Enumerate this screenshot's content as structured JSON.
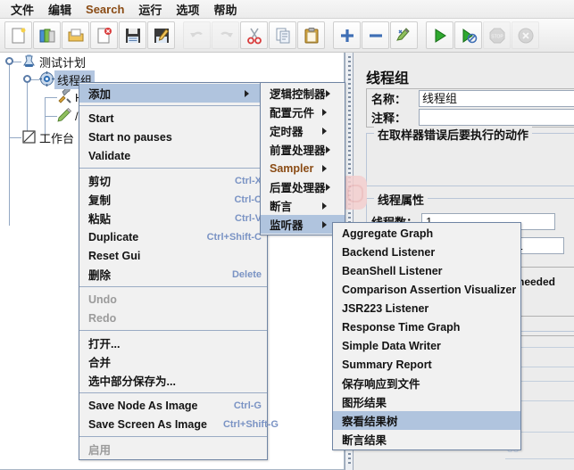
{
  "menubar": {
    "items": [
      {
        "label": "文件",
        "accent": false
      },
      {
        "label": "编辑",
        "accent": false
      },
      {
        "label": "Search",
        "accent": true
      },
      {
        "label": "运行",
        "accent": false
      },
      {
        "label": "选项",
        "accent": false
      },
      {
        "label": "帮助",
        "accent": false
      }
    ]
  },
  "toolbar": {
    "buttons": [
      {
        "name": "new-icon",
        "enabled": true
      },
      {
        "name": "templates-icon",
        "enabled": true
      },
      {
        "name": "open-icon",
        "enabled": true
      },
      {
        "name": "close-icon",
        "enabled": true
      },
      {
        "name": "save-icon",
        "enabled": true
      },
      {
        "name": "save-as-icon",
        "enabled": true
      },
      {
        "name": "undo-icon",
        "enabled": false
      },
      {
        "name": "redo-icon",
        "enabled": false
      },
      {
        "name": "cut-icon",
        "enabled": true
      },
      {
        "name": "copy-icon",
        "enabled": true
      },
      {
        "name": "paste-icon",
        "enabled": true
      },
      {
        "name": "expand-all-icon",
        "enabled": true
      },
      {
        "name": "collapse-all-icon",
        "enabled": true
      },
      {
        "name": "toggle-icon",
        "enabled": true
      },
      {
        "name": "start-icon",
        "enabled": true
      },
      {
        "name": "start-no-pauses-icon",
        "enabled": true
      },
      {
        "name": "stop-icon",
        "enabled": false
      },
      {
        "name": "shutdown-icon",
        "enabled": false
      }
    ]
  },
  "tree": {
    "nodes": [
      {
        "label": "测试计划",
        "selected": false
      },
      {
        "label": "线程组",
        "selected": true
      },
      {
        "label": "H",
        "selected": false
      },
      {
        "label": "/",
        "selected": false
      },
      {
        "label": "工作台",
        "selected": false
      }
    ]
  },
  "context_menu": {
    "items": [
      {
        "label": "添加",
        "accel": "",
        "submenu": true,
        "highlighted": true,
        "disabled": false,
        "accent": false
      },
      {
        "type": "separator"
      },
      {
        "label": "Start",
        "accel": "",
        "submenu": false,
        "highlighted": false,
        "disabled": false,
        "accent": false
      },
      {
        "label": "Start no pauses",
        "accel": "",
        "submenu": false,
        "highlighted": false,
        "disabled": false,
        "accent": false
      },
      {
        "label": "Validate",
        "accel": "",
        "submenu": false,
        "highlighted": false,
        "disabled": false,
        "accent": false
      },
      {
        "type": "separator"
      },
      {
        "label": "剪切",
        "accel": "Ctrl-X",
        "submenu": false,
        "highlighted": false,
        "disabled": false,
        "accent": false
      },
      {
        "label": "复制",
        "accel": "Ctrl-C",
        "submenu": false,
        "highlighted": false,
        "disabled": false,
        "accent": false
      },
      {
        "label": "粘贴",
        "accel": "Ctrl-V",
        "submenu": false,
        "highlighted": false,
        "disabled": false,
        "accent": false
      },
      {
        "label": "Duplicate",
        "accel": "Ctrl+Shift-C",
        "submenu": false,
        "highlighted": false,
        "disabled": false,
        "accent": false
      },
      {
        "label": "Reset Gui",
        "accel": "",
        "submenu": false,
        "highlighted": false,
        "disabled": false,
        "accent": false
      },
      {
        "label": "删除",
        "accel": "Delete",
        "submenu": false,
        "highlighted": false,
        "disabled": false,
        "accent": false
      },
      {
        "type": "separator"
      },
      {
        "label": "Undo",
        "accel": "",
        "submenu": false,
        "highlighted": false,
        "disabled": true,
        "accent": false
      },
      {
        "label": "Redo",
        "accel": "",
        "submenu": false,
        "highlighted": false,
        "disabled": true,
        "accent": false
      },
      {
        "type": "separator"
      },
      {
        "label": "打开...",
        "accel": "",
        "submenu": false,
        "highlighted": false,
        "disabled": false,
        "accent": false
      },
      {
        "label": "合并",
        "accel": "",
        "submenu": false,
        "highlighted": false,
        "disabled": false,
        "accent": false
      },
      {
        "label": "选中部分保存为...",
        "accel": "",
        "submenu": false,
        "highlighted": false,
        "disabled": false,
        "accent": false
      },
      {
        "type": "separator"
      },
      {
        "label": "Save Node As Image",
        "accel": "Ctrl-G",
        "submenu": false,
        "highlighted": false,
        "disabled": false,
        "accent": false
      },
      {
        "label": "Save Screen As Image",
        "accel": "Ctrl+Shift-G",
        "submenu": false,
        "highlighted": false,
        "disabled": false,
        "accent": false
      },
      {
        "type": "separator"
      },
      {
        "label": "启用",
        "accel": "",
        "submenu": false,
        "highlighted": false,
        "disabled": true,
        "accent": false
      }
    ]
  },
  "add_submenu": {
    "items": [
      {
        "label": "逻辑控制器",
        "submenu": true,
        "highlighted": false,
        "accent": false
      },
      {
        "label": "配置元件",
        "submenu": true,
        "highlighted": false,
        "accent": false
      },
      {
        "label": "定时器",
        "submenu": true,
        "highlighted": false,
        "accent": false
      },
      {
        "label": "前置处理器",
        "submenu": true,
        "highlighted": false,
        "accent": false
      },
      {
        "label": "Sampler",
        "submenu": true,
        "highlighted": false,
        "accent": true
      },
      {
        "label": "后置处理器",
        "submenu": true,
        "highlighted": false,
        "accent": false
      },
      {
        "label": "断言",
        "submenu": true,
        "highlighted": false,
        "accent": false
      },
      {
        "label": "监听器",
        "submenu": true,
        "highlighted": true,
        "accent": false
      }
    ]
  },
  "listener_submenu": {
    "items": [
      {
        "label": "Aggregate Graph",
        "highlighted": false
      },
      {
        "label": "Backend Listener",
        "highlighted": false
      },
      {
        "label": "BeanShell Listener",
        "highlighted": false
      },
      {
        "label": "Comparison Assertion Visualizer",
        "highlighted": false
      },
      {
        "label": "JSR223 Listener",
        "highlighted": false
      },
      {
        "label": "Response Time Graph",
        "highlighted": false
      },
      {
        "label": "Simple Data Writer",
        "highlighted": false
      },
      {
        "label": "Summary Report",
        "highlighted": false
      },
      {
        "label": "保存响应到文件",
        "highlighted": false
      },
      {
        "label": "图形结果",
        "highlighted": false
      },
      {
        "label": "察看结果树",
        "highlighted": true
      },
      {
        "label": "断言结果",
        "highlighted": false
      }
    ]
  },
  "thread_group_panel": {
    "title": "线程组",
    "name_label": "名称：",
    "name_value": "线程组",
    "comment_label": "注释：",
    "comment_value": "",
    "error_action_group": "在取样器错误后要执行的动作",
    "thread_props_group": "线程属性",
    "thread_count_label": "线程数：",
    "thread_count_value": "1",
    "ramp_up_suffix_label": "):",
    "ramp_up_value": "1",
    "scheduler_text": "til needed",
    "faint_numbers": [
      "88",
      "88"
    ]
  },
  "colors": {
    "accent_text": "#8a4b14",
    "menu_highlight": "#b0c4de",
    "tree_selection": "#b3c6e0",
    "accel_text": "#7a93c4",
    "annotation_blob": "#f4cfcf"
  }
}
